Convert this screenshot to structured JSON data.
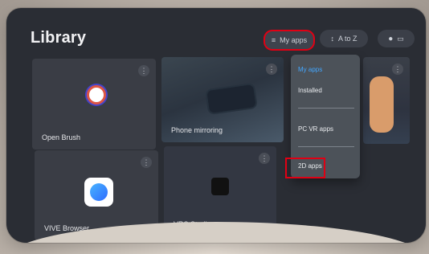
{
  "header": {
    "title": "Library",
    "filter_label": "My apps",
    "sort_label": "A to Z"
  },
  "dropdown": {
    "items": [
      "My apps",
      "Installed",
      "PC VR apps",
      "2D apps"
    ]
  },
  "tiles": [
    {
      "label": "Open Brush"
    },
    {
      "label": "Phone mirroring"
    },
    {
      "label": "VIVE Browser"
    },
    {
      "label": "VRS Studio"
    }
  ],
  "colors": {
    "highlight": "#e00014",
    "accent": "#43a7ff"
  }
}
